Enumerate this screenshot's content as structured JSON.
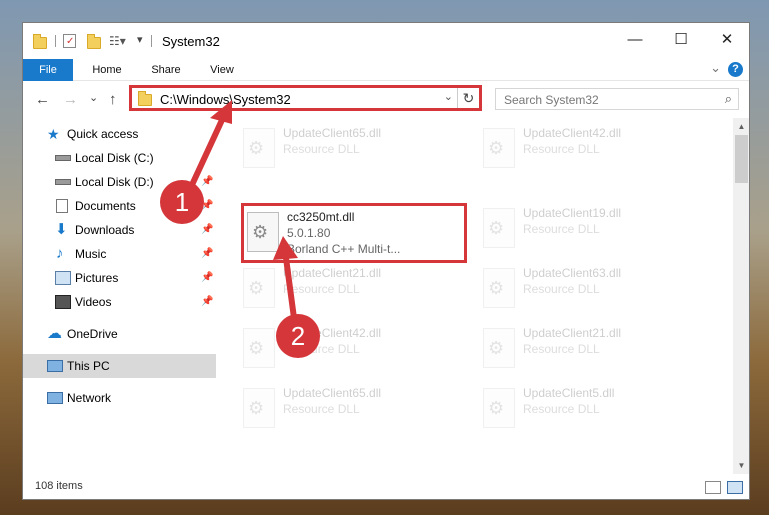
{
  "window": {
    "title": "System32",
    "minimize": "—",
    "maximize": "☐",
    "close": "✕"
  },
  "ribbon": {
    "tabs": [
      "File",
      "Home",
      "Share",
      "View"
    ],
    "help": "?",
    "expand": "⌄"
  },
  "address": {
    "path": "C:\\Windows\\System32",
    "refresh": "↻",
    "dropdown": "⌄"
  },
  "search": {
    "placeholder": "Search System32"
  },
  "nav": {
    "back": "←",
    "forward": "→",
    "recent": "⌄",
    "up": "↑",
    "items": [
      {
        "label": "Quick access",
        "icon": "star-icon",
        "pinned": false
      },
      {
        "label": "Local Disk (C:)",
        "icon": "drive-icon",
        "pinned": false
      },
      {
        "label": "Local Disk (D:)",
        "icon": "drive-icon",
        "pinned": true
      },
      {
        "label": "Documents",
        "icon": "documents-icon",
        "pinned": true
      },
      {
        "label": "Downloads",
        "icon": "downloads-icon",
        "pinned": true
      },
      {
        "label": "Music",
        "icon": "music-icon",
        "pinned": true
      },
      {
        "label": "Pictures",
        "icon": "pictures-icon",
        "pinned": true
      },
      {
        "label": "Videos",
        "icon": "videos-icon",
        "pinned": true
      },
      {
        "label": "OneDrive",
        "icon": "cloud-icon",
        "pinned": false
      },
      {
        "label": "This PC",
        "icon": "computer-icon",
        "pinned": false
      },
      {
        "label": "Network",
        "icon": "network-icon",
        "pinned": false
      }
    ]
  },
  "files": {
    "highlighted": {
      "name": "cc3250mt.dll",
      "version": "5.0.1.80",
      "description": "Borland C++ Multi-t..."
    },
    "faded_left": [
      {
        "name": "UpdateClient65.dll",
        "type": "Resource DLL"
      },
      {
        "name": "UpdateClient21.dll",
        "type": "Resource DLL"
      },
      {
        "name": "UpdateClient42.dll",
        "type": "Resource DLL"
      },
      {
        "name": "UpdateClient65.dll",
        "type": "Resource DLL"
      }
    ],
    "faded_right": [
      {
        "name": "UpdateClient42.dll",
        "type": "Resource DLL"
      },
      {
        "name": "UpdateClient19.dll",
        "type": "Resource DLL"
      },
      {
        "name": "UpdateClient63.dll",
        "type": "Resource DLL"
      },
      {
        "name": "UpdateClient21.dll",
        "type": "Resource DLL"
      },
      {
        "name": "UpdateClient5.dll",
        "type": "Resource DLL"
      }
    ]
  },
  "status": {
    "item_count": "108 items"
  },
  "annotations": {
    "step1": "1",
    "step2": "2",
    "color": "#d4363a"
  }
}
